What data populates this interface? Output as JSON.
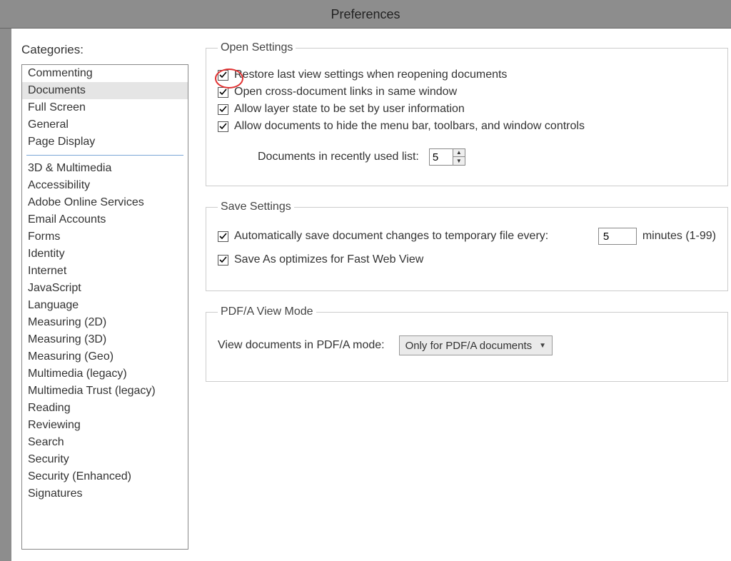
{
  "window": {
    "title": "Preferences"
  },
  "sidebar": {
    "title": "Categories:",
    "primary": [
      "Commenting",
      "Documents",
      "Full Screen",
      "General",
      "Page Display"
    ],
    "selected_index": 1,
    "secondary": [
      "3D & Multimedia",
      "Accessibility",
      "Adobe Online Services",
      "Email Accounts",
      "Forms",
      "Identity",
      "Internet",
      "JavaScript",
      "Language",
      "Measuring (2D)",
      "Measuring (3D)",
      "Measuring (Geo)",
      "Multimedia (legacy)",
      "Multimedia Trust (legacy)",
      "Reading",
      "Reviewing",
      "Search",
      "Security",
      "Security (Enhanced)",
      "Signatures"
    ]
  },
  "open_settings": {
    "legend": "Open Settings",
    "restore_last_view": {
      "label": "Restore last view settings when reopening documents",
      "checked": true
    },
    "cross_doc_links": {
      "label": "Open cross-document links in same window",
      "checked": true
    },
    "layer_state": {
      "label": "Allow layer state to be set by user information",
      "checked": true
    },
    "hide_menu": {
      "label": "Allow documents to hide the menu bar, toolbars, and window controls",
      "checked": true
    },
    "recent_docs": {
      "label": "Documents in recently used list:",
      "value": "5"
    }
  },
  "save_settings": {
    "legend": "Save Settings",
    "autosave": {
      "label": "Automatically save document changes to temporary file every:",
      "checked": true,
      "value": "5",
      "suffix": "minutes (1-99)"
    },
    "fast_web": {
      "label": "Save As optimizes for Fast Web View",
      "checked": true
    }
  },
  "pdfa": {
    "legend": "PDF/A View Mode",
    "label": "View documents in PDF/A mode:",
    "value": "Only for PDF/A documents"
  }
}
